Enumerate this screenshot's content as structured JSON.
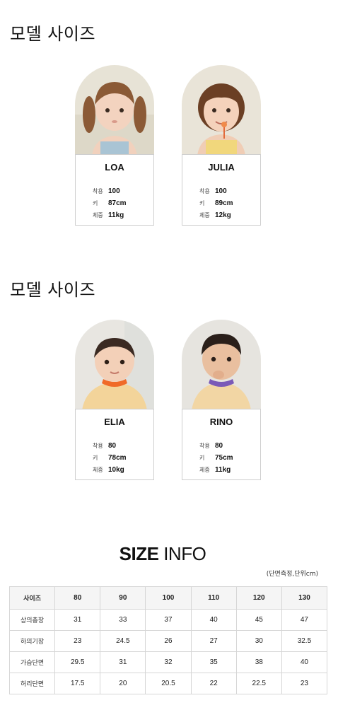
{
  "sections": [
    {
      "title": "모델 사이즈",
      "models": [
        {
          "name": "LOA",
          "rows": [
            {
              "label": "착용",
              "value": "100"
            },
            {
              "label": "키",
              "value": "87cm"
            },
            {
              "label": "체중",
              "value": "11kg"
            }
          ]
        },
        {
          "name": "JULIA",
          "rows": [
            {
              "label": "착용",
              "value": "100"
            },
            {
              "label": "키",
              "value": "89cm"
            },
            {
              "label": "체중",
              "value": "12kg"
            }
          ]
        }
      ]
    },
    {
      "title": "모델 사이즈",
      "models": [
        {
          "name": "ELIA",
          "rows": [
            {
              "label": "착용",
              "value": "80"
            },
            {
              "label": "키",
              "value": "78cm"
            },
            {
              "label": "체중",
              "value": "10kg"
            }
          ]
        },
        {
          "name": "RINO",
          "rows": [
            {
              "label": "착용",
              "value": "80"
            },
            {
              "label": "키",
              "value": "75cm"
            },
            {
              "label": "체중",
              "value": "11kg"
            }
          ]
        }
      ]
    }
  ],
  "size_info": {
    "title_bold": "SIZE",
    "title_light": "INFO",
    "unit_note": "(단면측정,단위cm)",
    "headers": [
      "사이즈",
      "80",
      "90",
      "100",
      "110",
      "120",
      "130"
    ],
    "rows": [
      {
        "label": "상의총장",
        "values": [
          "31",
          "33",
          "37",
          "40",
          "45",
          "47"
        ]
      },
      {
        "label": "하의기장",
        "values": [
          "23",
          "24.5",
          "26",
          "27",
          "30",
          "32.5"
        ]
      },
      {
        "label": "가슴단면",
        "values": [
          "29.5",
          "31",
          "32",
          "35",
          "38",
          "40"
        ]
      },
      {
        "label": "허리단면",
        "values": [
          "17.5",
          "20",
          "20.5",
          "22",
          "22.5",
          "23"
        ]
      }
    ]
  }
}
